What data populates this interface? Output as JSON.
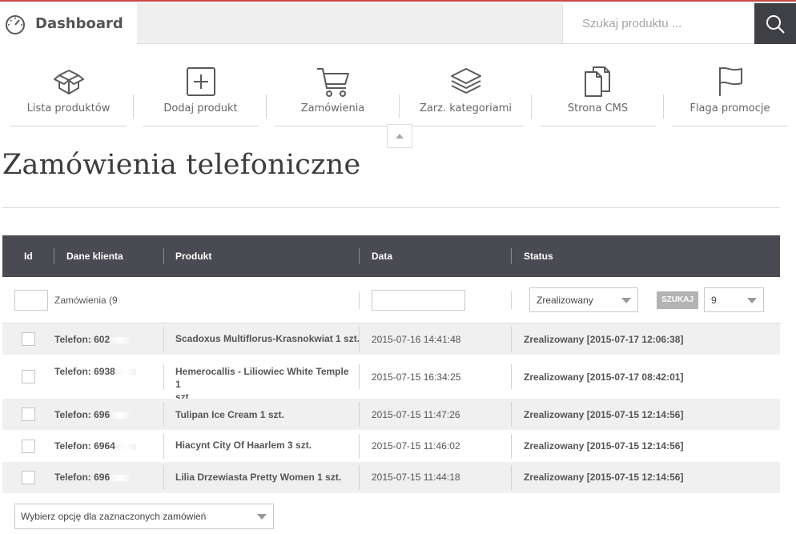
{
  "header": {
    "title": "Dashboard",
    "search_placeholder": "Szukaj produktu ...",
    "accent_color": "#c94a4a"
  },
  "quicklinks": [
    {
      "label": "Lista produktów",
      "icon": "box-icon"
    },
    {
      "label": "Dodaj produkt",
      "icon": "plus-square-icon"
    },
    {
      "label": "Zamówienia",
      "icon": "cart-icon"
    },
    {
      "label": "Zarz. kategoriami",
      "icon": "layers-icon"
    },
    {
      "label": "Strona CMS",
      "icon": "documents-icon"
    },
    {
      "label": "Flaga promocje",
      "icon": "flag-icon"
    }
  ],
  "page": {
    "title": "Zamówienia telefoniczne"
  },
  "table": {
    "headers": {
      "id": "Id",
      "client": "Dane klienta",
      "product": "Produkt",
      "date": "Data",
      "status": "Status"
    },
    "filter": {
      "client_text": "Zamówienia (9",
      "status_selected": "Zrealizowany",
      "search_button": "SZUKAJ",
      "per_page_selected": "9"
    },
    "rows": [
      {
        "client": "Telefon: 602",
        "product": "Scadoxus Multiflorus-Krasnokwiat 1 szt.",
        "product2": "",
        "date": "2015-07-16 14:41:48",
        "status": "Zrealizowany [2015-07-17 12:06:38]"
      },
      {
        "client": "Telefon: 6938",
        "product": "Hemerocallis - Liliowiec White Temple 1",
        "product2": "szt.",
        "date": "2015-07-15 16:34:25",
        "status": "Zrealizowany [2015-07-17 08:42:01]"
      },
      {
        "client": "Telefon: 696",
        "product": "Tulipan Ice Cream 1 szt.",
        "product2": "",
        "date": "2015-07-15 11:47:26",
        "status": "Zrealizowany [2015-07-15 12:14:56]"
      },
      {
        "client": "Telefon: 6964",
        "product": "Hiacynt City Of Haarlem 3 szt.",
        "product2": "",
        "date": "2015-07-15 11:46:02",
        "status": "Zrealizowany [2015-07-15 12:14:56]"
      },
      {
        "client": "Telefon: 696",
        "product": "Lilia Drzewiasta Pretty Women 1 szt.",
        "product2": "",
        "date": "2015-07-15 11:44:18",
        "status": "Zrealizowany [2015-07-15 12:14:56]"
      }
    ],
    "bulk_action_placeholder": "Wybierz opcję dla zaznaczonych zamówień"
  }
}
